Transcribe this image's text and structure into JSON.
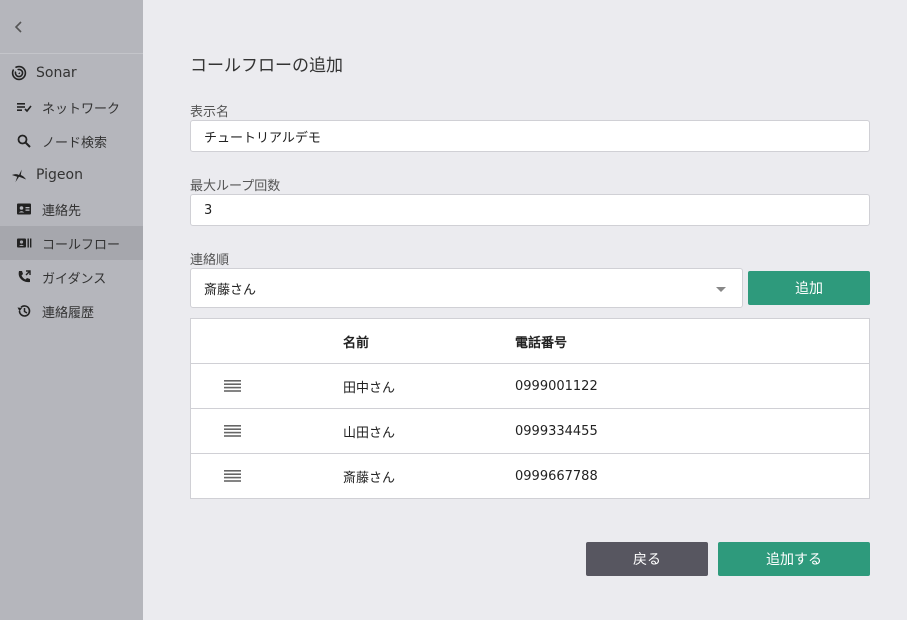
{
  "sidebar": {
    "apps": [
      {
        "label": "Sonar",
        "icon": "sonar-icon",
        "items": [
          {
            "label": "ネットワーク",
            "icon": "network-list-icon"
          },
          {
            "label": "ノード検索",
            "icon": "search-icon"
          }
        ]
      },
      {
        "label": "Pigeon",
        "icon": "pigeon-bird-icon",
        "items": [
          {
            "label": "連絡先",
            "icon": "contact-card-icon"
          },
          {
            "label": "コールフロー",
            "icon": "call-flow-icon"
          },
          {
            "label": "ガイダンス",
            "icon": "phone-guidance-icon"
          },
          {
            "label": "連絡履歴",
            "icon": "history-icon"
          }
        ]
      }
    ],
    "active_item": "コールフロー"
  },
  "page": {
    "title": "コールフローの追加"
  },
  "form": {
    "display_name_label": "表示名",
    "display_name_value": "チュートリアルデモ",
    "max_loop_label": "最大ループ回数",
    "max_loop_value": "3",
    "contact_order_label": "連絡順",
    "contact_select_value": "斎藤さん",
    "add_button": "追加"
  },
  "table": {
    "headers": {
      "name": "名前",
      "phone": "電話番号"
    },
    "rows": [
      {
        "name": "田中さん",
        "phone": "0999001122"
      },
      {
        "name": "山田さん",
        "phone": "0999334455"
      },
      {
        "name": "斎藤さん",
        "phone": "0999667788"
      }
    ]
  },
  "actions": {
    "back": "戻る",
    "submit": "追加する"
  },
  "colors": {
    "primary": "#2e9a7c",
    "secondary": "#575660",
    "sidebar_bg": "#b5b6bc",
    "sidebar_active": "#a6a7ad",
    "page_bg": "#ebebef"
  }
}
